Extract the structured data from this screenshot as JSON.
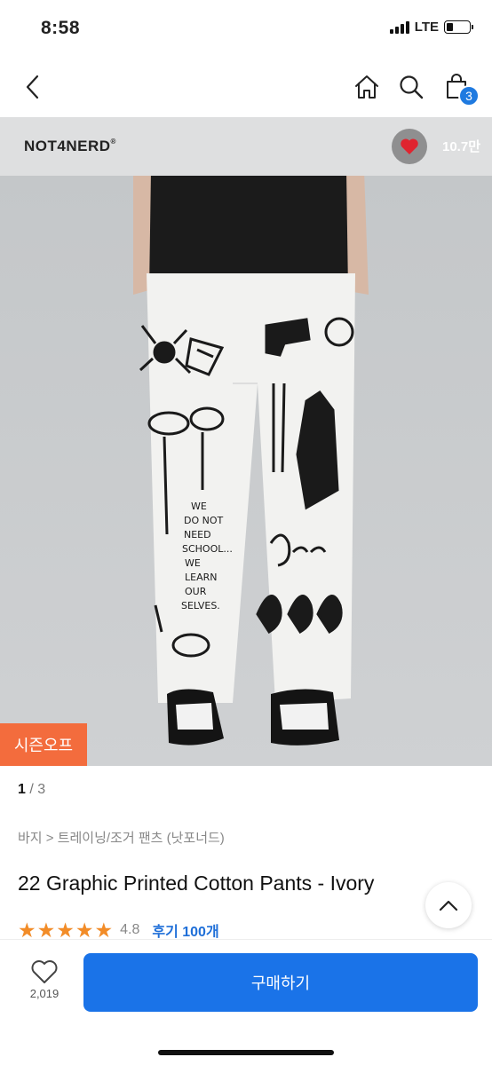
{
  "status_bar": {
    "time": "8:58",
    "network": "LTE",
    "battery_level": 0.3
  },
  "nav": {
    "cart_count": "3"
  },
  "hero": {
    "brand": "NOT4NERD",
    "brand_mark": "®",
    "favorite_count": "10.7만",
    "season_badge": "시즌오프",
    "colors": {
      "season_badge": "#f36c3d",
      "heart": "#e0242f"
    }
  },
  "pager": {
    "current": "1",
    "separator": " / ",
    "total": "3"
  },
  "breadcrumb": "바지 > 트레이닝/조거 팬츠 (낫포너드)",
  "product": {
    "title": "22 Graphic Printed Cotton Pants - Ivory",
    "stars": 5,
    "rating": "4.8",
    "reviews": "후기 100개"
  },
  "bottom_bar": {
    "like_count": "2,019",
    "buy_label": "구매하기",
    "accent": "#1a73e8"
  }
}
